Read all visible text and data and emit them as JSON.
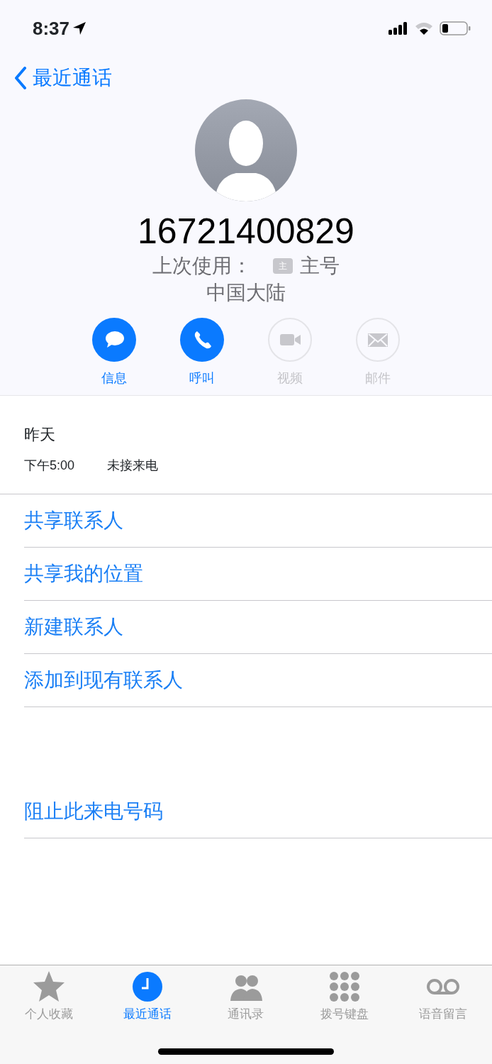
{
  "status_bar": {
    "time": "8:37"
  },
  "nav": {
    "back_label": "最近通话"
  },
  "contact": {
    "number": "16721400829",
    "last_used_label": "上次使用：",
    "sim_badge": "主",
    "line": "主号",
    "region": "中国大陆"
  },
  "actions": [
    {
      "kind": "message",
      "label": "信息",
      "disabled": false
    },
    {
      "kind": "call",
      "label": "呼叫",
      "disabled": false
    },
    {
      "kind": "video",
      "label": "视频",
      "disabled": true
    },
    {
      "kind": "mail",
      "label": "邮件",
      "disabled": true
    }
  ],
  "call_history": {
    "date": "昨天",
    "entries": [
      {
        "time": "下午5:00",
        "type": "未接来电"
      }
    ]
  },
  "options": [
    "共享联系人",
    "共享我的位置",
    "新建联系人",
    "添加到现有联系人"
  ],
  "block_option": "阻止此来电号码",
  "tabs": [
    {
      "kind": "favorites",
      "label": "个人收藏",
      "selected": false
    },
    {
      "kind": "recents",
      "label": "最近通话",
      "selected": true
    },
    {
      "kind": "contacts",
      "label": "通讯录",
      "selected": false
    },
    {
      "kind": "keypad",
      "label": "拨号键盘",
      "selected": false
    },
    {
      "kind": "voicemail",
      "label": "语音留言",
      "selected": false
    }
  ]
}
